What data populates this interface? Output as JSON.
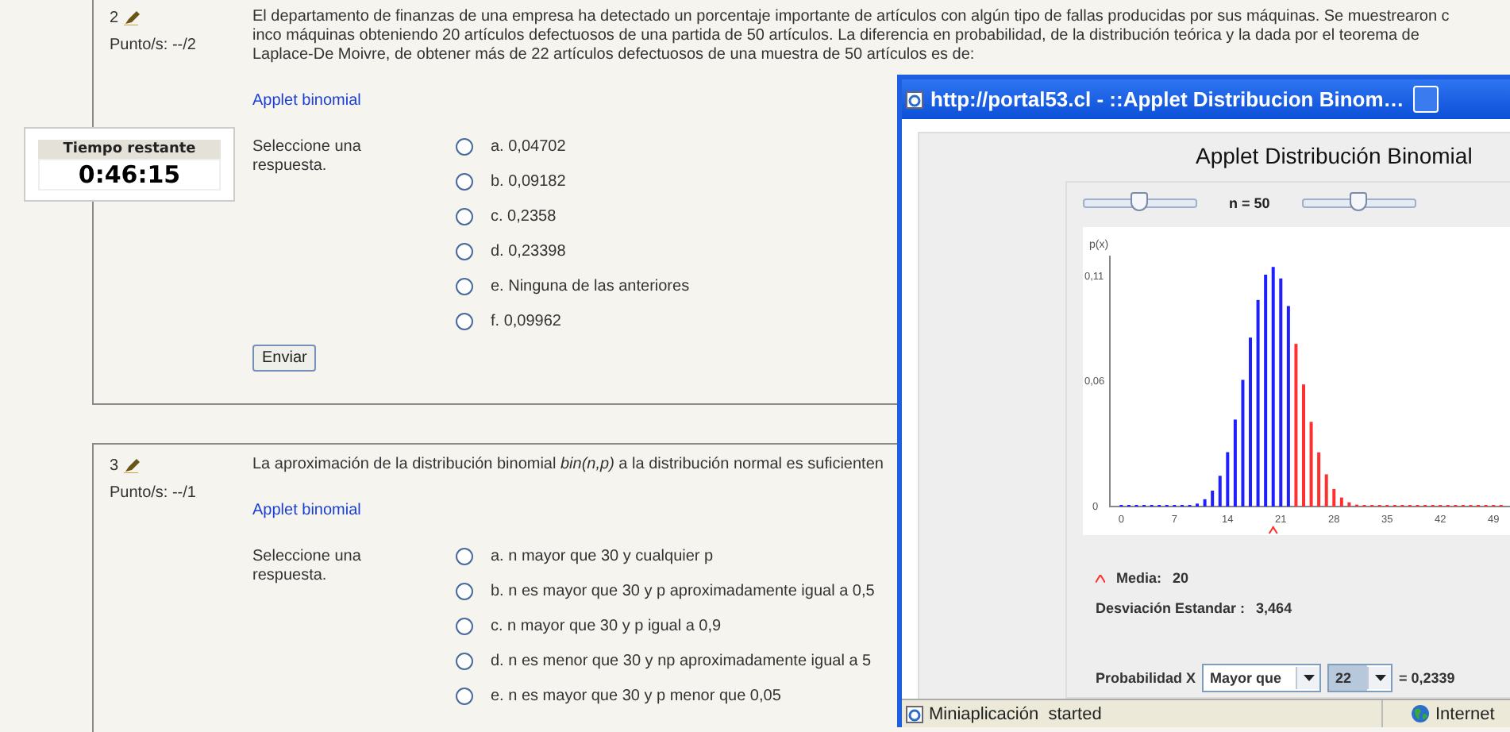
{
  "timer": {
    "title": "Tiempo restante",
    "time": "0:46:15"
  },
  "questions": [
    {
      "number": "2",
      "points": "Punto/s: --/2",
      "text_lines": [
        "El departamento de finanzas de una empresa ha detectado un porcentaje importante de artículos con algún tipo de fallas producidas por sus máquinas. Se muestrearon c",
        "inco máquinas obteniendo 20 artículos defectuosos de una partida de 50 artículos. La diferencia en probabilidad, de la distribución teórica y la dada por el teorema de",
        "Laplace-De Moivre, de obtener más de 22 artículos defectuosos de una muestra de 50 artículos es de:"
      ],
      "link": "Applet binomial",
      "prompt": "Seleccione una respuesta.",
      "options": [
        {
          "label": "a. 0,04702",
          "selected": false
        },
        {
          "label": "b. 0,09182",
          "selected": false
        },
        {
          "label": "c. 0,2358",
          "selected": false
        },
        {
          "label": "d. 0,23398",
          "selected": false
        },
        {
          "label": "e. Ninguna de las anteriores",
          "selected": false
        },
        {
          "label": "f. 0,09962",
          "selected": false
        }
      ],
      "submit": "Enviar"
    },
    {
      "number": "3",
      "points": "Punto/s: --/1",
      "text_lines": [
        "La aproximación de la distribución binomial *bin(n,p)* a la distribución normal es suficienten"
      ],
      "link": "Applet binomial",
      "prompt": "Seleccione una respuesta.",
      "options": [
        {
          "label": "a. n mayor que 30 y cualquier p",
          "selected": false
        },
        {
          "label": "b. n es mayor que 30 y p aproximadamente igual a 0,5",
          "selected": false
        },
        {
          "label": "c. n mayor que 30 y p igual a 0,9",
          "selected": false
        },
        {
          "label": "d. n es menor que 30 y np aproximadamente igual a 5",
          "selected": false
        },
        {
          "label": "e. n es mayor que 30 y p menor que 0,05",
          "selected": false
        }
      ]
    }
  ],
  "popup": {
    "title": "http://portal53.cl - ::Applet Distribucion Binom…",
    "heading": "Applet Distribución Binomial",
    "sliders": [
      {
        "level": 0.5
      },
      {
        "level": 0.5
      }
    ],
    "n_label": "n = 50",
    "chart_data": {
      "type": "bar",
      "ylabel": "p(x)",
      "x": [
        0,
        1,
        2,
        3,
        4,
        5,
        6,
        7,
        8,
        9,
        10,
        11,
        12,
        13,
        14,
        15,
        16,
        17,
        18,
        19,
        20,
        21,
        22,
        23,
        24,
        25,
        26,
        27,
        28,
        29,
        30,
        31,
        32,
        33,
        34,
        35,
        36,
        37,
        38,
        39,
        40,
        41,
        42,
        43,
        44,
        45,
        46,
        47,
        48,
        49,
        50
      ],
      "xlim": [
        -1.5,
        51.8
      ],
      "series": [
        {
          "color": "#1f1fff",
          "values": [
            0,
            0,
            0,
            0,
            0,
            0,
            0,
            0.0001,
            0.0002,
            0.0005,
            0.0014,
            0.0035,
            0.0076,
            0.0147,
            0.026,
            0.0416,
            0.0606,
            0.0808,
            0.0988,
            0.1109,
            0.1146,
            0.1091,
            0.0959,
            null,
            null,
            null,
            null,
            null,
            null,
            null,
            null,
            null,
            null,
            null,
            null,
            null,
            null,
            null,
            null,
            null,
            null,
            null,
            null,
            null,
            null,
            null,
            null,
            null,
            null,
            null,
            null
          ]
        },
        {
          "color": "#ff3030",
          "values": [
            null,
            null,
            null,
            null,
            null,
            null,
            null,
            null,
            null,
            null,
            null,
            null,
            null,
            null,
            null,
            null,
            null,
            null,
            null,
            null,
            null,
            null,
            null,
            0.0778,
            0.0584,
            0.0405,
            0.0259,
            0.0154,
            0.0084,
            0.0043,
            0.002,
            0.0009,
            0.0003,
            0.0001,
            0,
            0,
            0,
            0,
            0,
            0,
            0,
            0,
            0,
            0,
            0,
            0,
            0,
            0,
            0,
            0,
            0
          ]
        }
      ],
      "xticks": [
        0,
        7,
        14,
        21,
        28,
        35,
        42,
        49
      ],
      "yticks": [
        {
          "value": 0,
          "label": "0"
        },
        {
          "value": 0.06,
          "label": "0,06"
        },
        {
          "value": 0.11,
          "label": "0,11"
        }
      ],
      "ylim": [
        0,
        0.12
      ]
    },
    "mean_label": "Media:",
    "mean_value": "20",
    "sd_label": "Desviación Estandar :",
    "sd_value": "3,464",
    "prob_label": "Probabilidad X",
    "dropdowns": [
      {
        "value": "Mayor que",
        "focused": false
      },
      {
        "value": "22",
        "focused": true
      }
    ],
    "result": "= 0,2339",
    "status": "Miniaplicación  started",
    "zone": "Internet"
  }
}
